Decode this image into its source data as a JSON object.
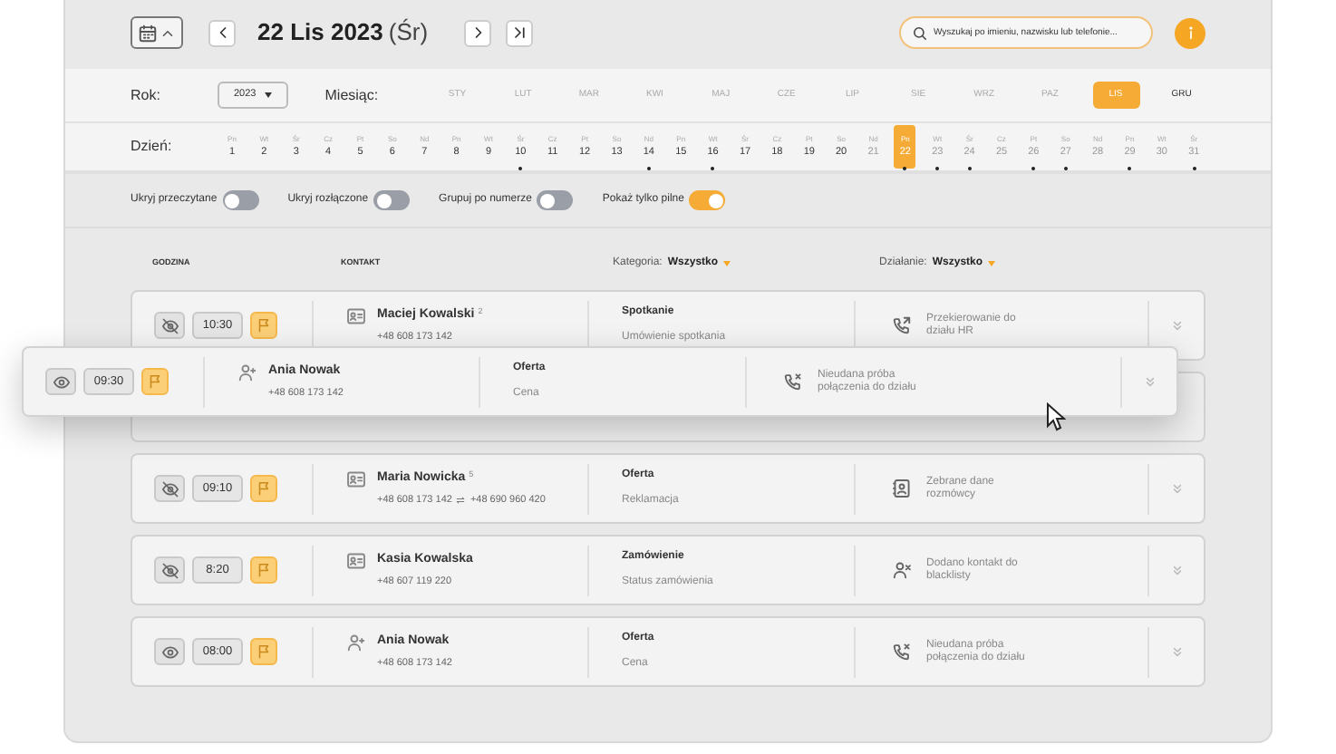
{
  "header": {
    "date": "22 Lis 2023",
    "weekday": "(Śr)",
    "search": {
      "placeholder": "Wyszukaj po imieniu, nazwisku lub telefonie..."
    }
  },
  "year": {
    "label": "Rok:",
    "value": "2023"
  },
  "month": {
    "label": "Miesiąc:",
    "items": [
      {
        "label": "STY",
        "selected": false,
        "muted": true
      },
      {
        "label": "LUT",
        "selected": false,
        "muted": true
      },
      {
        "label": "MAR",
        "selected": false,
        "muted": true
      },
      {
        "label": "KWI",
        "selected": false,
        "muted": true
      },
      {
        "label": "MAJ",
        "selected": false,
        "muted": true
      },
      {
        "label": "CZE",
        "selected": false,
        "muted": true
      },
      {
        "label": "LIP",
        "selected": false,
        "muted": true
      },
      {
        "label": "SIE",
        "selected": false,
        "muted": true
      },
      {
        "label": "WRZ",
        "selected": false,
        "muted": true
      },
      {
        "label": "PAZ",
        "selected": false,
        "muted": true
      },
      {
        "label": "LIS",
        "selected": true
      },
      {
        "label": "GRU",
        "selected": false,
        "muted": false
      }
    ]
  },
  "day": {
    "label": "Dzień:",
    "items": [
      {
        "weekday": "Pn",
        "day": "1",
        "selected": false,
        "muted": false,
        "dot": false
      },
      {
        "weekday": "Wt",
        "day": "2",
        "selected": false,
        "muted": false,
        "dot": false
      },
      {
        "weekday": "Śr",
        "day": "3",
        "selected": false,
        "muted": false,
        "dot": false
      },
      {
        "weekday": "Cz",
        "day": "4",
        "selected": false,
        "muted": false,
        "dot": false
      },
      {
        "weekday": "Pt",
        "day": "5",
        "selected": false,
        "muted": false,
        "dot": false
      },
      {
        "weekday": "So",
        "day": "6",
        "selected": false,
        "muted": false,
        "dot": false
      },
      {
        "weekday": "Nd",
        "day": "7",
        "selected": false,
        "muted": false,
        "dot": false
      },
      {
        "weekday": "Pn",
        "day": "8",
        "selected": false,
        "muted": false,
        "dot": false
      },
      {
        "weekday": "Wt",
        "day": "9",
        "selected": false,
        "muted": false,
        "dot": false
      },
      {
        "weekday": "Śr",
        "day": "10",
        "selected": false,
        "muted": false,
        "dot": true
      },
      {
        "weekday": "Cz",
        "day": "11",
        "selected": false,
        "muted": false,
        "dot": false
      },
      {
        "weekday": "Pt",
        "day": "12",
        "selected": false,
        "muted": false,
        "dot": false
      },
      {
        "weekday": "So",
        "day": "13",
        "selected": false,
        "muted": false,
        "dot": false
      },
      {
        "weekday": "Nd",
        "day": "14",
        "selected": false,
        "muted": false,
        "dot": true
      },
      {
        "weekday": "Pn",
        "day": "15",
        "selected": false,
        "muted": false,
        "dot": false
      },
      {
        "weekday": "Wt",
        "day": "16",
        "selected": false,
        "muted": false,
        "dot": true
      },
      {
        "weekday": "Śr",
        "day": "17",
        "selected": false,
        "muted": false,
        "dot": false
      },
      {
        "weekday": "Cz",
        "day": "18",
        "selected": false,
        "muted": false,
        "dot": false
      },
      {
        "weekday": "Pt",
        "day": "19",
        "selected": false,
        "muted": false,
        "dot": false
      },
      {
        "weekday": "So",
        "day": "20",
        "selected": false,
        "muted": false,
        "dot": false
      },
      {
        "weekday": "Nd",
        "day": "21",
        "selected": false,
        "muted": true,
        "dot": false
      },
      {
        "weekday": "Pn",
        "day": "22",
        "selected": true,
        "dot": true
      },
      {
        "weekday": "Wt",
        "day": "23",
        "selected": false,
        "muted": true,
        "dot": true
      },
      {
        "weekday": "Śr",
        "day": "24",
        "selected": false,
        "muted": true,
        "dot": true
      },
      {
        "weekday": "Cz",
        "day": "25",
        "selected": false,
        "muted": true,
        "dot": false
      },
      {
        "weekday": "Pt",
        "day": "26",
        "selected": false,
        "muted": true,
        "dot": true
      },
      {
        "weekday": "So",
        "day": "27",
        "selected": false,
        "muted": true,
        "dot": true
      },
      {
        "weekday": "Nd",
        "day": "28",
        "selected": false,
        "muted": true,
        "dot": false
      },
      {
        "weekday": "Pn",
        "day": "29",
        "selected": false,
        "muted": true,
        "dot": true
      },
      {
        "weekday": "Wt",
        "day": "30",
        "selected": false,
        "muted": true,
        "dot": false
      },
      {
        "weekday": "Śr",
        "day": "31",
        "selected": false,
        "muted": true,
        "dot": true
      }
    ]
  },
  "toggles": [
    {
      "label": "Ukryj przeczytane",
      "on": false
    },
    {
      "label": "Ukryj rozłączone",
      "on": false
    },
    {
      "label": "Grupuj po numerze",
      "on": false
    },
    {
      "label": "Pokaż tylko pilne",
      "on": true
    }
  ],
  "columns": {
    "time": "GODZINA",
    "contact": "KONTAKT",
    "category": {
      "label": "Kategoria:",
      "value": "Wszystko"
    },
    "action": {
      "label": "Działanie:",
      "value": "Wszystko"
    }
  },
  "rows": [
    {
      "hidden": true,
      "time": "10:30",
      "flagged": true,
      "contact": {
        "kind": "card",
        "name": "Maciej Kowalski",
        "count": "2",
        "phones": [
          "+48 608 173 142"
        ]
      },
      "category": "Spotkanie",
      "subcategory": "Umówienie spotkania",
      "action": {
        "kind": "forward",
        "text": "Przekierowanie do działu HR"
      }
    },
    {
      "hidden": false,
      "time": "09:30",
      "flagged": true,
      "contact": {
        "kind": "person",
        "name": "Ania Nowak",
        "phones": [
          "+48 608 173 142"
        ]
      },
      "category": "Oferta",
      "subcategory": "Cena",
      "action": {
        "kind": "missed",
        "text": "Nieudana próba połączenia do działu"
      },
      "dragged": true
    },
    {
      "hidden": true,
      "time": "09:10",
      "flagged": true,
      "contact": {
        "kind": "card",
        "name": "Maria Nowicka",
        "count": "5",
        "phones": [
          "+48 608 173 142",
          "+48 690 960 420"
        ]
      },
      "category": "Oferta",
      "subcategory": "Reklamacja",
      "action": {
        "kind": "badge",
        "text": "Zebrane dane rozmówcy"
      }
    },
    {
      "hidden": true,
      "time": "8:20",
      "flagged": true,
      "contact": {
        "kind": "card",
        "name": "Kasia Kowalska",
        "phones": [
          "+48 607 119 220"
        ]
      },
      "category": "Zamówienie",
      "subcategory": "Status zamówienia",
      "action": {
        "kind": "block",
        "text": "Dodano kontakt do blacklisty"
      }
    },
    {
      "hidden": false,
      "time": "08:00",
      "flagged": true,
      "contact": {
        "kind": "person",
        "name": "Ania Nowak",
        "phones": [
          "+48 608 173 142"
        ]
      },
      "category": "Oferta",
      "subcategory": "Cena",
      "action": {
        "kind": "missed",
        "text": "Nieudana próba połączenia do działu"
      }
    }
  ]
}
